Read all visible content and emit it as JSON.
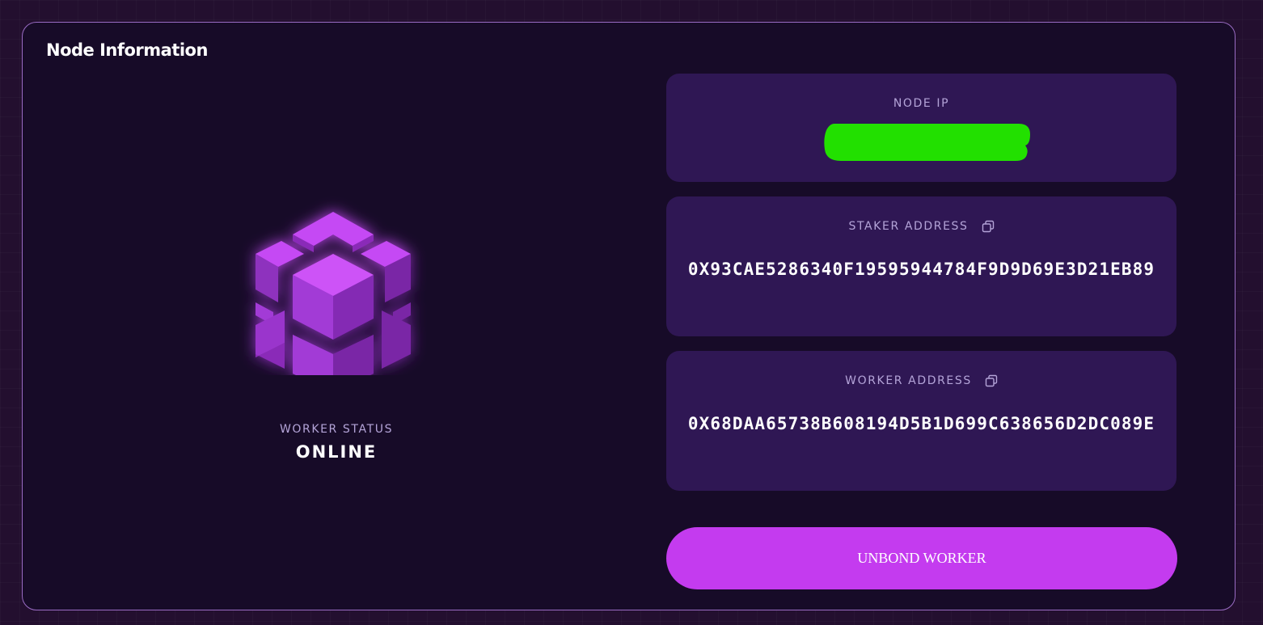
{
  "panel": {
    "title": "Node Information"
  },
  "worker": {
    "status_label": "WORKER STATUS",
    "status_value": "ONLINE",
    "icon": "cube-icon"
  },
  "node_ip": {
    "label": "NODE IP",
    "value_redacted": true
  },
  "staker": {
    "label": "STAKER ADDRESS",
    "address": "0X93CAE5286340F19595944784F9D9D69E3D21EB89",
    "copy_icon": "copy-icon"
  },
  "worker_address": {
    "label": "WORKER ADDRESS",
    "address": "0X68DAA65738B608194D5B1D699C638656D2DC089E",
    "copy_icon": "copy-icon"
  },
  "actions": {
    "unbond_label": "UNBOND WORKER"
  },
  "colors": {
    "page_bg": "#230f2f",
    "panel_bg": "#170b28",
    "card_bg": "#2f1754",
    "accent": "#c43bef",
    "redaction": "#22e000",
    "label": "#b4a4d8"
  }
}
